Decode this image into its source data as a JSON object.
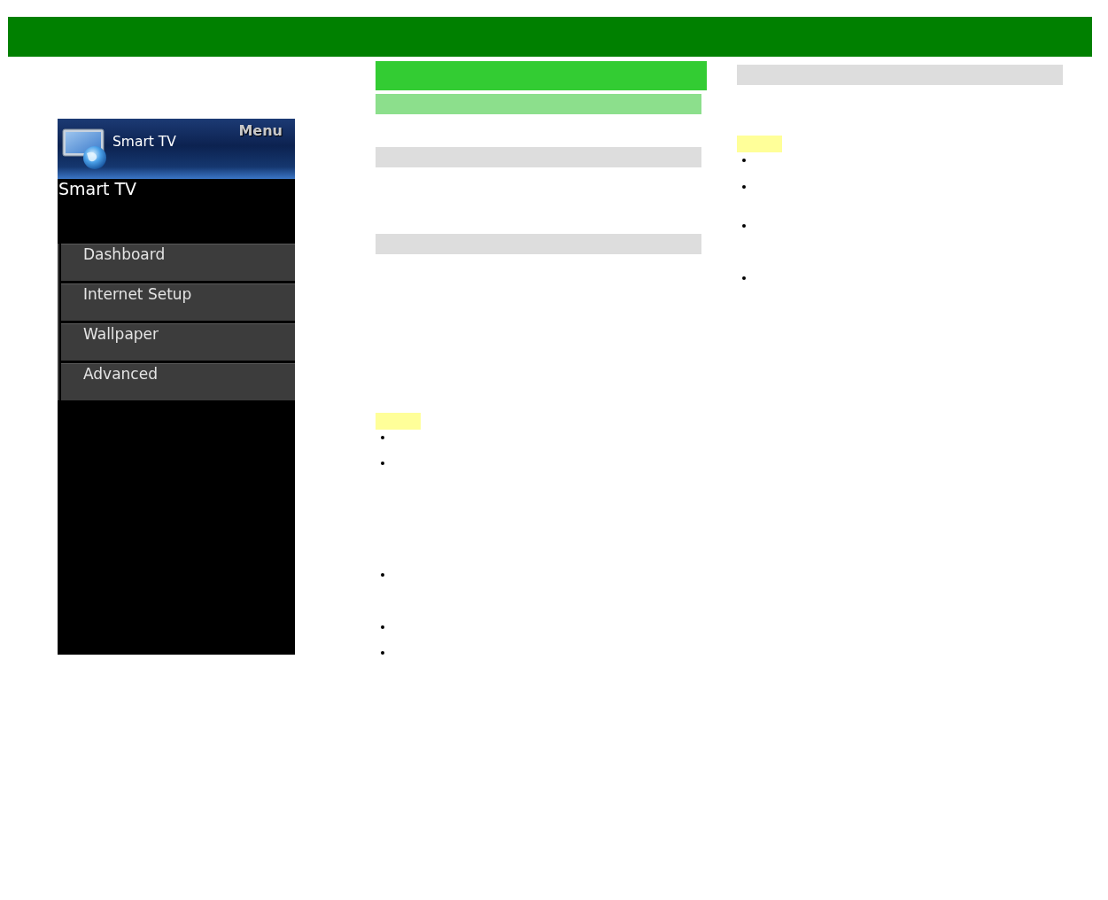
{
  "tv_menu": {
    "header_title": "Smart TV",
    "menu_label": "Menu",
    "page_title": "Smart TV",
    "items": [
      {
        "label": "Dashboard"
      },
      {
        "label": "Internet Setup"
      },
      {
        "label": "Wallpaper"
      },
      {
        "label": "Advanced"
      }
    ]
  }
}
